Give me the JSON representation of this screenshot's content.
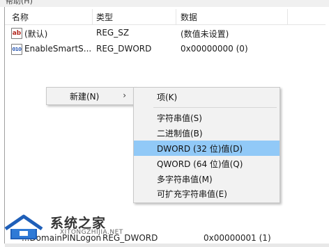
{
  "menubar": {
    "label": "帮助(H)"
  },
  "header": {
    "col_name": "名称",
    "col_type": "类型",
    "col_data": "数据"
  },
  "rows": [
    {
      "icon": "string-value-icon",
      "glyph": "ab",
      "name": "(默认)",
      "type": "REG_SZ",
      "data": "(数值未设置)"
    },
    {
      "icon": "binary-value-icon",
      "glyph": "010",
      "name": "EnableSmartS...",
      "type": "REG_DWORD",
      "data": "0x00000000 (0)"
    }
  ],
  "bottom_row": {
    "name": "...DomainPINLogon",
    "type": "REG_DWORD",
    "data": "0x00000001 (1)"
  },
  "context_menu": {
    "new_label": "新建(N)",
    "arrow": "›"
  },
  "submenu": {
    "key": "项(K)",
    "items": [
      "字符串值(S)",
      "二进制值(B)",
      "DWORD (32 位)值(D)",
      "QWORD (64 位)值(Q)",
      "多字符串值(M)",
      "可扩充字符串值(E)"
    ],
    "highlight_color": "#91c9f7"
  },
  "watermark": {
    "title": "系统之家",
    "url": "XITONGZHIJIA.NET"
  }
}
